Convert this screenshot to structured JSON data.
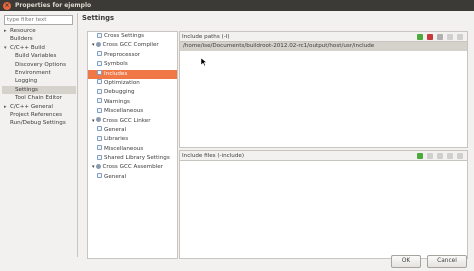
{
  "window": {
    "title": "Properties for ejemplo",
    "close_glyph": "×"
  },
  "filter": {
    "placeholder": "type filter text"
  },
  "nav": {
    "items": [
      {
        "label": "Resource",
        "level": 1,
        "expandable": true
      },
      {
        "label": "Builders",
        "level": 1
      },
      {
        "label": "C/C++ Build",
        "level": 1,
        "expandable": true,
        "expanded": true
      },
      {
        "label": "Build Variables",
        "level": 2
      },
      {
        "label": "Discovery Options",
        "level": 2
      },
      {
        "label": "Environment",
        "level": 2
      },
      {
        "label": "Logging",
        "level": 2
      },
      {
        "label": "Settings",
        "level": 2,
        "selected": true
      },
      {
        "label": "Tool Chain Editor",
        "level": 2
      },
      {
        "label": "C/C++ General",
        "level": 1,
        "expandable": true
      },
      {
        "label": "Project References",
        "level": 1
      },
      {
        "label": "Run/Debug Settings",
        "level": 1
      }
    ]
  },
  "page_title": "Settings",
  "tool_tree": {
    "items": [
      {
        "label": "Cross Settings",
        "level": 1,
        "icon": "page"
      },
      {
        "label": "Cross GCC Compiler",
        "level": 0,
        "icon": "gear",
        "expanded": true
      },
      {
        "label": "Preprocessor",
        "level": 1,
        "icon": "page"
      },
      {
        "label": "Symbols",
        "level": 1,
        "icon": "page"
      },
      {
        "label": "Includes",
        "level": 1,
        "icon": "page",
        "selected": true
      },
      {
        "label": "Optimization",
        "level": 1,
        "icon": "page"
      },
      {
        "label": "Debugging",
        "level": 1,
        "icon": "page"
      },
      {
        "label": "Warnings",
        "level": 1,
        "icon": "page"
      },
      {
        "label": "Miscellaneous",
        "level": 1,
        "icon": "page"
      },
      {
        "label": "Cross GCC Linker",
        "level": 0,
        "icon": "gear",
        "expanded": true
      },
      {
        "label": "General",
        "level": 1,
        "icon": "page"
      },
      {
        "label": "Libraries",
        "level": 1,
        "icon": "page"
      },
      {
        "label": "Miscellaneous",
        "level": 1,
        "icon": "page"
      },
      {
        "label": "Shared Library Settings",
        "level": 1,
        "icon": "page"
      },
      {
        "label": "Cross GCC Assembler",
        "level": 0,
        "icon": "gear",
        "expanded": true
      },
      {
        "label": "General",
        "level": 1,
        "icon": "page"
      }
    ]
  },
  "include_paths": {
    "header": "Include paths (-I)",
    "paths": [
      "/home/ise/Documents/buildroot-2012.02-rc1/output/host/usr/include"
    ]
  },
  "include_files": {
    "header": "Include files (-include)"
  },
  "buttons": {
    "ok": "OK",
    "cancel": "Cancel"
  },
  "colors": {
    "selection": "#f07746",
    "titlebar": "#3b3a36",
    "close": "#e9673a"
  }
}
